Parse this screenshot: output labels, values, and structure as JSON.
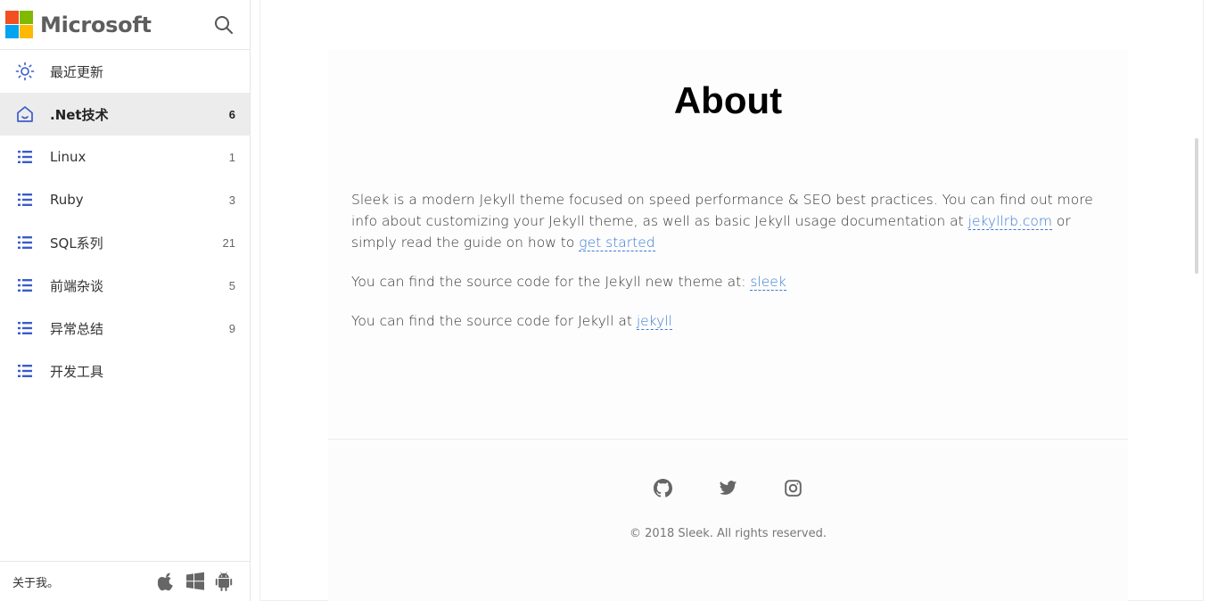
{
  "brand": {
    "name": "Microsoft",
    "logo_colors": [
      "#f25022",
      "#7fba00",
      "#00a4ef",
      "#ffb900"
    ]
  },
  "sidebar": {
    "items": [
      {
        "label": "最近更新",
        "count": "",
        "icon": "sun-icon"
      },
      {
        "label": ".Net技术",
        "count": "6",
        "icon": "home-icon",
        "active": true
      },
      {
        "label": "Linux",
        "count": "1",
        "icon": "list-icon"
      },
      {
        "label": "Ruby",
        "count": "3",
        "icon": "list-icon"
      },
      {
        "label": "SQL系列",
        "count": "21",
        "icon": "list-icon"
      },
      {
        "label": "前端杂谈",
        "count": "5",
        "icon": "list-icon"
      },
      {
        "label": "异常总结",
        "count": "9",
        "icon": "list-icon"
      },
      {
        "label": "开发工具",
        "count": "",
        "icon": "list-icon"
      }
    ],
    "footer": {
      "about_label": "关于我。",
      "platform_icons": [
        "apple-icon",
        "windows-icon",
        "android-icon"
      ]
    },
    "accent_color": "#3a5ccc"
  },
  "main": {
    "title": "About",
    "paragraphs": {
      "p1_a": "Sleek is a modern Jekyll theme focused on speed performance & SEO best practices. You can find out more info about customizing your Jekyll theme, as well as basic Jekyll usage documentation at ",
      "p1_link1": "jekyllrb.com",
      "p1_b": " or simply read the guide on how to ",
      "p1_link2": "get started",
      "p2_a": "You can find the source code for the Jekyll new theme at: ",
      "p2_link": "sleek",
      "p3_a": "You can find the source code for Jekyll at ",
      "p3_link": "jekyll"
    },
    "link_color": "#3a7bd5"
  },
  "footer": {
    "social_icons": [
      "github-icon",
      "twitter-icon",
      "instagram-icon"
    ],
    "copyright": "© 2018 Sleek. All rights reserved."
  }
}
